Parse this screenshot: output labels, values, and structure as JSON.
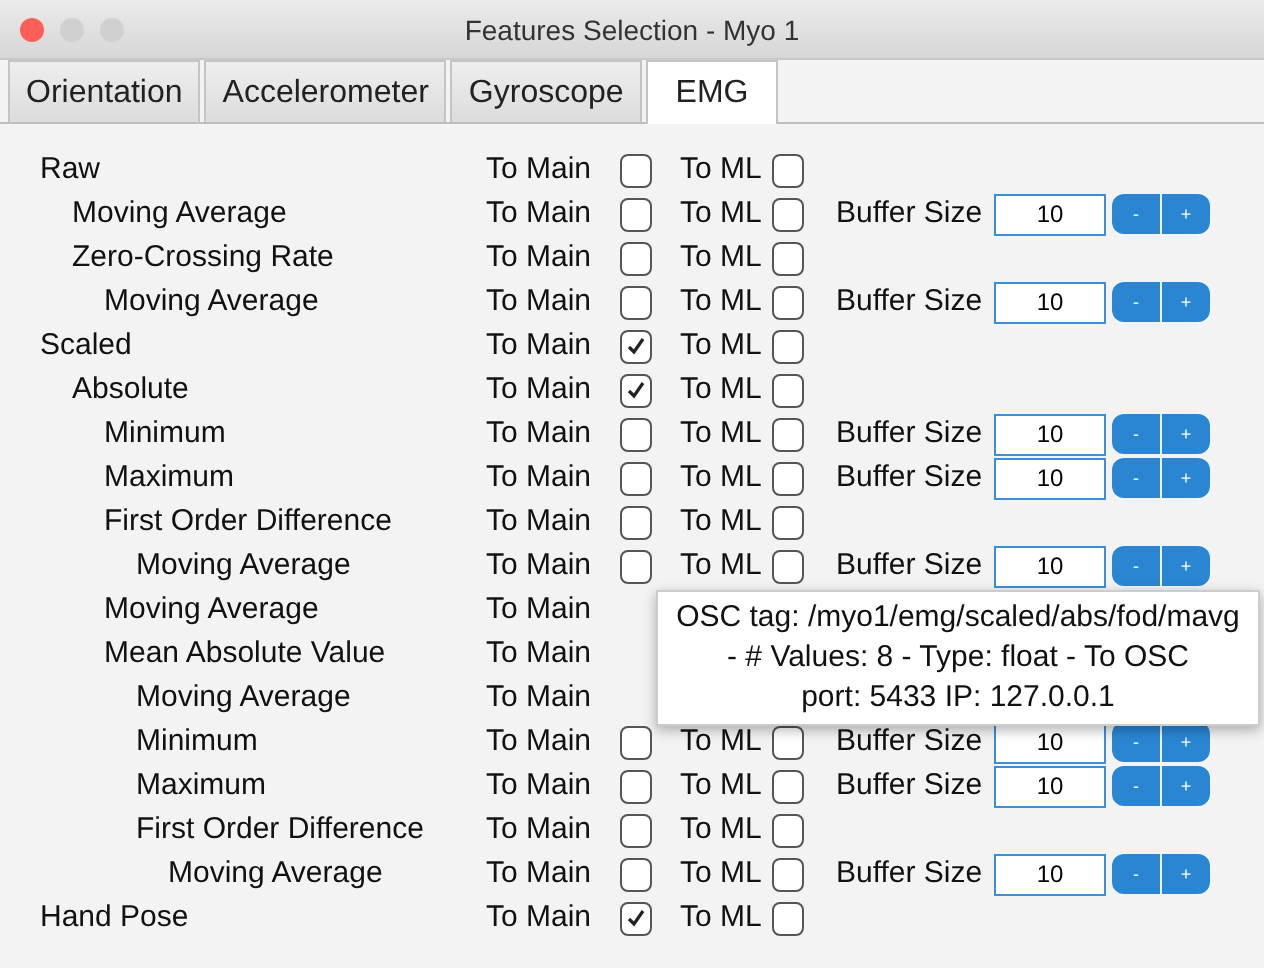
{
  "window": {
    "title": "Features Selection - Myo 1"
  },
  "tabs": [
    {
      "label": "Orientation",
      "selected": false
    },
    {
      "label": "Accelerometer",
      "selected": false
    },
    {
      "label": "Gyroscope",
      "selected": false
    },
    {
      "label": "EMG",
      "selected": true
    }
  ],
  "features": [
    {
      "label": "Raw",
      "to_main": {
        "label": "To Main",
        "checked": false
      },
      "to_ml": {
        "label": "To ML",
        "checked": false
      },
      "children": [
        {
          "label": "Moving Average",
          "to_main": {
            "label": "To Main",
            "checked": false
          },
          "to_ml": {
            "label": "To ML",
            "checked": false
          },
          "buffer": {
            "label": "Buffer Size",
            "value": "10",
            "buttons": [
              "-",
              "+"
            ]
          }
        },
        {
          "label": "Zero-Crossing Rate",
          "to_main": {
            "label": "To Main",
            "checked": false
          },
          "to_ml": {
            "label": "To ML",
            "checked": false
          },
          "children": [
            {
              "label": "Moving Average",
              "to_main": {
                "label": "To Main",
                "checked": false
              },
              "to_ml": {
                "label": "To ML",
                "checked": false
              },
              "buffer": {
                "label": "Buffer Size",
                "value": "10",
                "buttons": [
                  "-",
                  "+"
                ]
              }
            }
          ]
        }
      ]
    },
    {
      "label": "Scaled",
      "to_main": {
        "label": "To Main",
        "checked": true
      },
      "to_ml": {
        "label": "To ML",
        "checked": false
      },
      "children": [
        {
          "label": "Absolute",
          "to_main": {
            "label": "To Main",
            "checked": true
          },
          "to_ml": {
            "label": "To ML",
            "checked": false
          },
          "children": [
            {
              "label": "Minimum",
              "to_main": {
                "label": "To Main",
                "checked": false
              },
              "to_ml": {
                "label": "To ML",
                "checked": false
              },
              "buffer": {
                "label": "Buffer Size",
                "value": "10",
                "buttons": [
                  "-",
                  "+"
                ]
              }
            },
            {
              "label": "Maximum",
              "to_main": {
                "label": "To Main",
                "checked": false
              },
              "to_ml": {
                "label": "To ML",
                "checked": false
              },
              "buffer": {
                "label": "Buffer Size",
                "value": "10",
                "buttons": [
                  "-",
                  "+"
                ]
              }
            },
            {
              "label": "First Order Difference",
              "to_main": {
                "label": "To Main",
                "checked": false
              },
              "to_ml": {
                "label": "To ML",
                "checked": false
              },
              "children": [
                {
                  "label": "Moving Average",
                  "to_main": {
                    "label": "To Main",
                    "checked": false
                  },
                  "to_ml": {
                    "label": "To ML",
                    "checked": false
                  },
                  "buffer": {
                    "label": "Buffer Size",
                    "value": "10",
                    "buttons": [
                      "-",
                      "+"
                    ]
                  }
                }
              ]
            },
            {
              "label": "Moving Average",
              "to_main": {
                "label": "To Main"
              }
            },
            {
              "label": "Mean Absolute Value",
              "to_main": {
                "label": "To Main"
              },
              "children": [
                {
                  "label": "Moving Average",
                  "to_main": {
                    "label": "To Main"
                  }
                },
                {
                  "label": "Minimum",
                  "to_main": {
                    "label": "To Main",
                    "checked": false
                  },
                  "to_ml": {
                    "label": "To ML",
                    "checked": false
                  },
                  "buffer": {
                    "label": "Buffer Size",
                    "value": "10",
                    "buttons": [
                      "-",
                      "+"
                    ]
                  }
                },
                {
                  "label": "Maximum",
                  "to_main": {
                    "label": "To Main",
                    "checked": false
                  },
                  "to_ml": {
                    "label": "To ML",
                    "checked": false
                  },
                  "buffer": {
                    "label": "Buffer Size",
                    "value": "10",
                    "buttons": [
                      "-",
                      "+"
                    ]
                  }
                },
                {
                  "label": "First Order Difference",
                  "to_main": {
                    "label": "To Main",
                    "checked": false
                  },
                  "to_ml": {
                    "label": "To ML",
                    "checked": false
                  },
                  "children": [
                    {
                      "label": "Moving Average",
                      "to_main": {
                        "label": "To Main",
                        "checked": false
                      },
                      "to_ml": {
                        "label": "To ML",
                        "checked": false
                      },
                      "buffer": {
                        "label": "Buffer Size",
                        "value": "10",
                        "buttons": [
                          "-",
                          "+"
                        ]
                      }
                    }
                  ]
                }
              ]
            }
          ]
        }
      ]
    },
    {
      "label": "Hand Pose",
      "to_main": {
        "label": "To Main",
        "checked": true
      },
      "to_ml": {
        "label": "To ML",
        "checked": false
      }
    }
  ],
  "tooltip": {
    "lines": [
      "OSC tag: /myo1/emg/scaled/abs/fod/mavg",
      "- # Values: 8 - Type: float - To OSC",
      "port: 5433 IP: 127.0.0.1"
    ]
  }
}
